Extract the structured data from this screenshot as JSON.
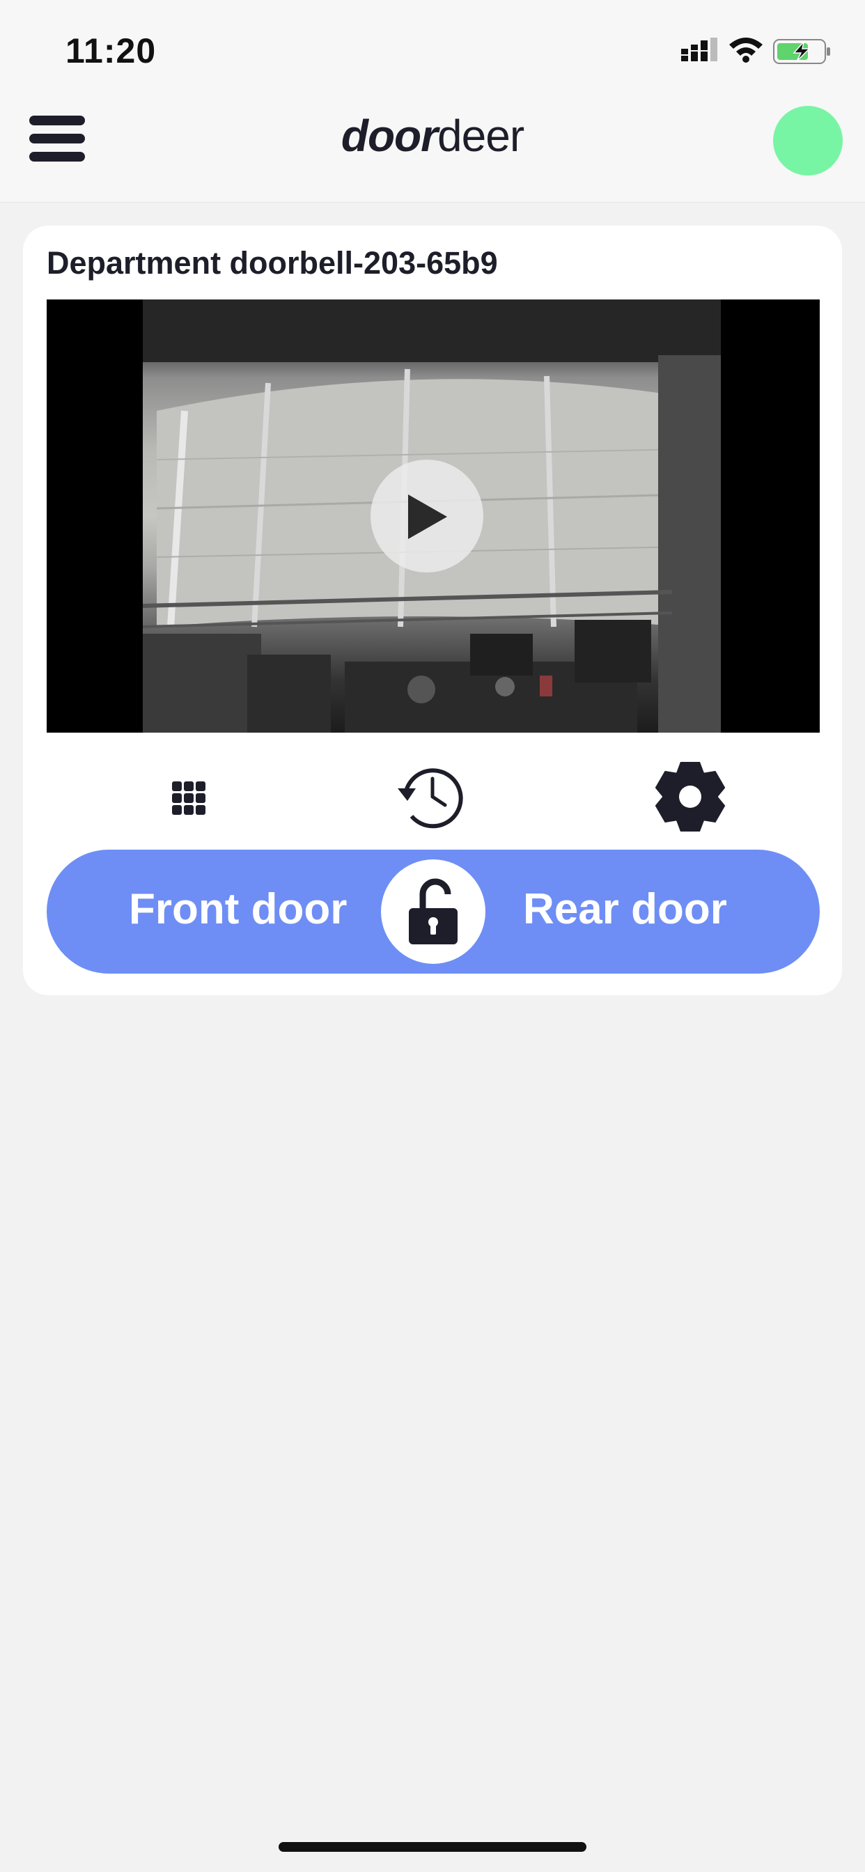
{
  "status_bar": {
    "time": "11:20"
  },
  "header": {
    "brand_bold": "door",
    "brand_regular": "deer",
    "status_color": "#78f5a4"
  },
  "device": {
    "name": "Department doorbell-203-65b9"
  },
  "doors": {
    "front_label": "Front door",
    "rear_label": "Rear door"
  },
  "icons": {
    "menu": "hamburger-menu-icon",
    "play": "play-icon",
    "keypad": "keypad-grid-icon",
    "history": "history-clock-icon",
    "settings": "gear-icon",
    "lock": "unlocked-padlock-icon"
  },
  "colors": {
    "accent": "#6e8ef5",
    "dark": "#1e1e2a",
    "background": "#f2f2f2"
  }
}
